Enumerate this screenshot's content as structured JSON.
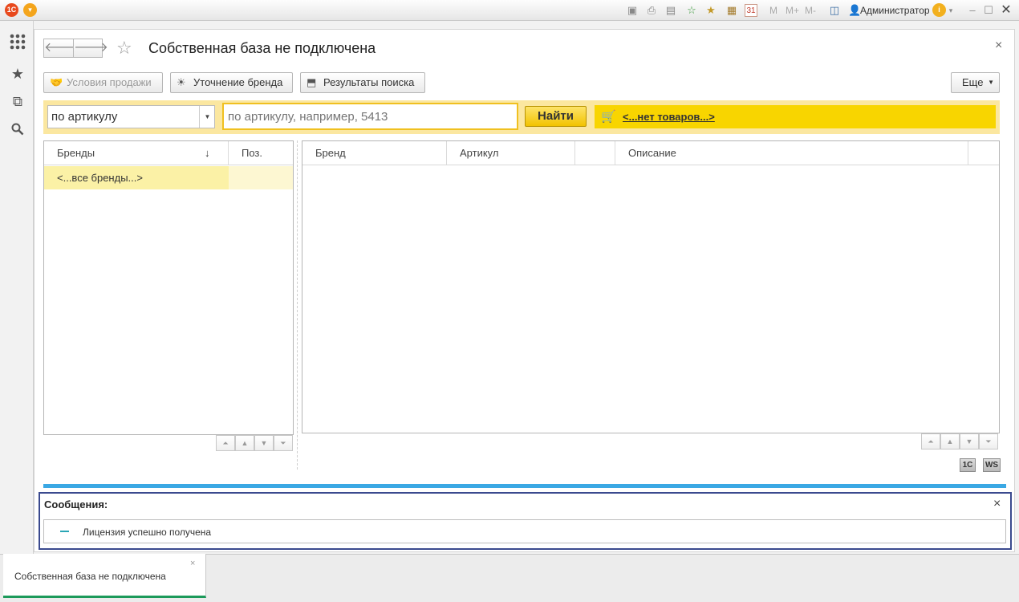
{
  "app": {
    "user_name": "Администратор",
    "m_buttons": [
      "M",
      "M+",
      "M-"
    ],
    "calendar_day": "31",
    "logo_text": "1С"
  },
  "form": {
    "title": "Собственная база не подключена",
    "close_glyph": "×"
  },
  "toolbar": {
    "sale_terms": "Условия продажи",
    "brand_refine": "Уточнение бренда",
    "search_results": "Результаты поиска",
    "more": "Еще"
  },
  "search": {
    "mode_value": "по артикулу",
    "placeholder": "по артикулу, например, 5413",
    "find_label": "Найти",
    "cart_text": "<...нет товаров...>"
  },
  "brands_table": {
    "columns": [
      "Бренды",
      "Поз."
    ],
    "sort_glyph": "↓",
    "rows": [
      {
        "brand": "<...все бренды...>",
        "pos": ""
      }
    ]
  },
  "results_table": {
    "columns": [
      "Бренд",
      "Артикул",
      "",
      "Описание"
    ]
  },
  "badges": {
    "onec": "1C",
    "ws": "WS"
  },
  "messages": {
    "title": "Сообщения:",
    "items": [
      "Лицензия успешно получена"
    ],
    "close_glyph": "×"
  },
  "tabs": [
    {
      "label": "Собственная база не подключена",
      "close_glyph": "×"
    }
  ],
  "colors": {
    "accent_yellow": "#f8d500",
    "search_strip": "#fbe7a0",
    "selected_row": "#fbf1a6",
    "blue_line": "#3aa8e4",
    "messages_border": "#3b4a8f",
    "active_tab_underline": "#1c9a5a"
  }
}
